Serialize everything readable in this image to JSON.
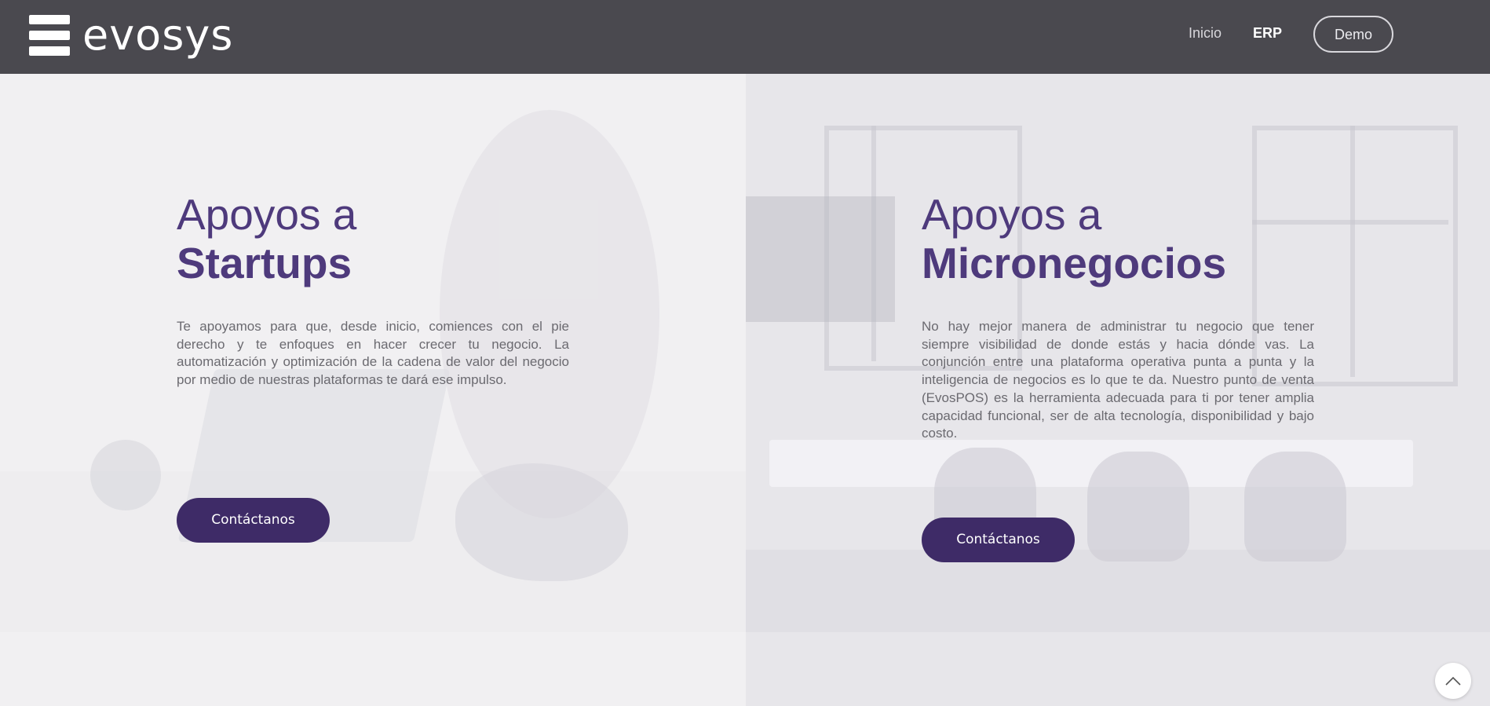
{
  "header": {
    "logo_text": "evosys",
    "nav": {
      "inicio": "Inicio",
      "erp": "ERP",
      "demo": "Demo"
    }
  },
  "sections": [
    {
      "title_light": "Apoyos a",
      "title_bold": "Startups",
      "body": "Te apoyamos para que, desde inicio, comiences con el pie derecho y te enfoques en hacer crecer tu negocio. La automatización y optimización de la cadena de valor del negocio por medio de nuestras plataformas te dará ese impulso.",
      "button": "Contáctanos"
    },
    {
      "title_light": "Apoyos a",
      "title_bold": "Micronegocios",
      "body": "No hay mejor manera de administrar tu negocio que tener siempre visibilidad de donde estás y hacia dónde vas. La conjunción entre una plataforma operativa punta a punta y la inteligencia de negocios es lo que te da. Nuestro punto de venta (EvosPOS) es la herramienta adecuada para ti por tener amplia capacidad funcional, ser de alta tecnología, disponibilidad y bajo costo.",
      "button": "Contáctanos"
    }
  ],
  "icons": {
    "logo": "evosys-logo-icon",
    "scroll_top": "chevron-up-icon"
  },
  "colors": {
    "header_bg": "#4a494f",
    "accent": "#4e3a7c",
    "button_bg": "#3e2b67"
  }
}
